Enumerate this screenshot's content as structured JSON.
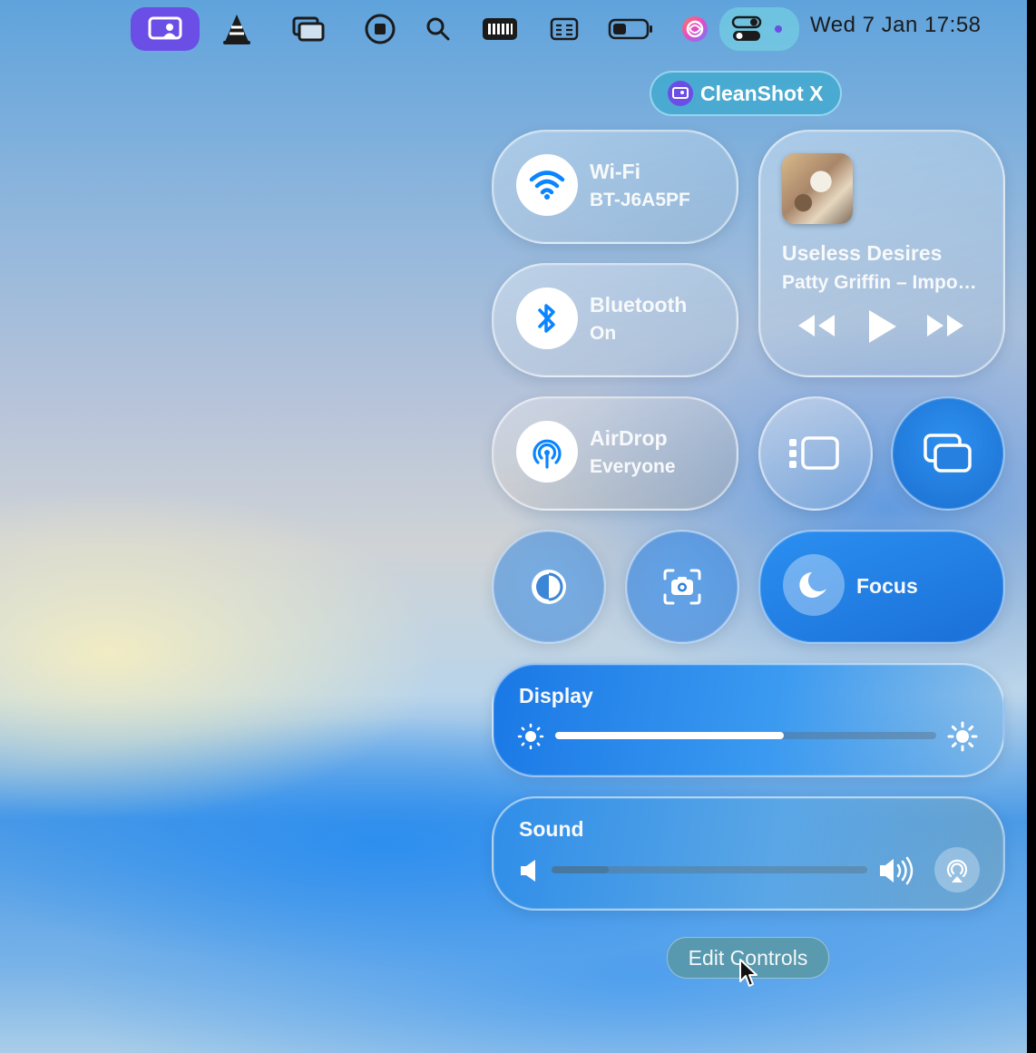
{
  "menubar": {
    "icons": [
      "cleanshot-icon",
      "vlc-icon",
      "stage-manager-icon",
      "screen-record-icon",
      "search-icon",
      "audio-meter-icon",
      "keyboard-icon",
      "battery-icon",
      "siri-icon",
      "control-center-icon"
    ],
    "clock": "Wed 7 Jan  17:58",
    "active_color": "#6b4ee6"
  },
  "cleanshot_pill": {
    "label": "CleanShot X"
  },
  "wifi": {
    "title": "Wi-Fi",
    "subtitle": "BT-J6A5PF"
  },
  "bluetooth": {
    "title": "Bluetooth",
    "subtitle": "On"
  },
  "airdrop": {
    "title": "AirDrop",
    "subtitle": "Everyone"
  },
  "now_playing": {
    "title": "Useless Desires",
    "artist": "Patty Griffin – Impo…"
  },
  "focus": {
    "label": "Focus"
  },
  "display": {
    "label": "Display",
    "brightness_level": 0.6
  },
  "sound": {
    "label": "Sound",
    "volume_level": 0.18
  },
  "edit_controls": {
    "label": "Edit Controls"
  },
  "colors": {
    "accent_blue": "#1a7fe8",
    "tile_icon_blue": "#0a84ff"
  }
}
